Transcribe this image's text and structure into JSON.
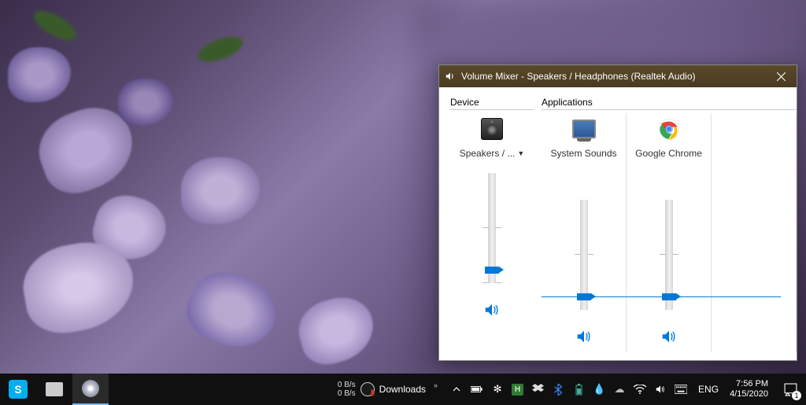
{
  "window": {
    "title": "Volume Mixer - Speakers / Headphones (Realtek Audio)",
    "device_section_label": "Device",
    "apps_section_label": "Applications",
    "device": {
      "name": "Speakers / ...",
      "volume": 10,
      "muted": false
    },
    "apps": [
      {
        "name": "System Sounds",
        "volume": 10,
        "muted": false,
        "icon": "system-sounds"
      },
      {
        "name": "Google Chrome",
        "volume": 10,
        "muted": false,
        "icon": "chrome"
      }
    ]
  },
  "taskbar": {
    "net_up": "0 B/s",
    "net_down": "0 B/s",
    "downloads_label": "Downloads",
    "language": "ENG",
    "time": "7:56 PM",
    "date": "4/15/2020",
    "notifications_count": "1"
  }
}
